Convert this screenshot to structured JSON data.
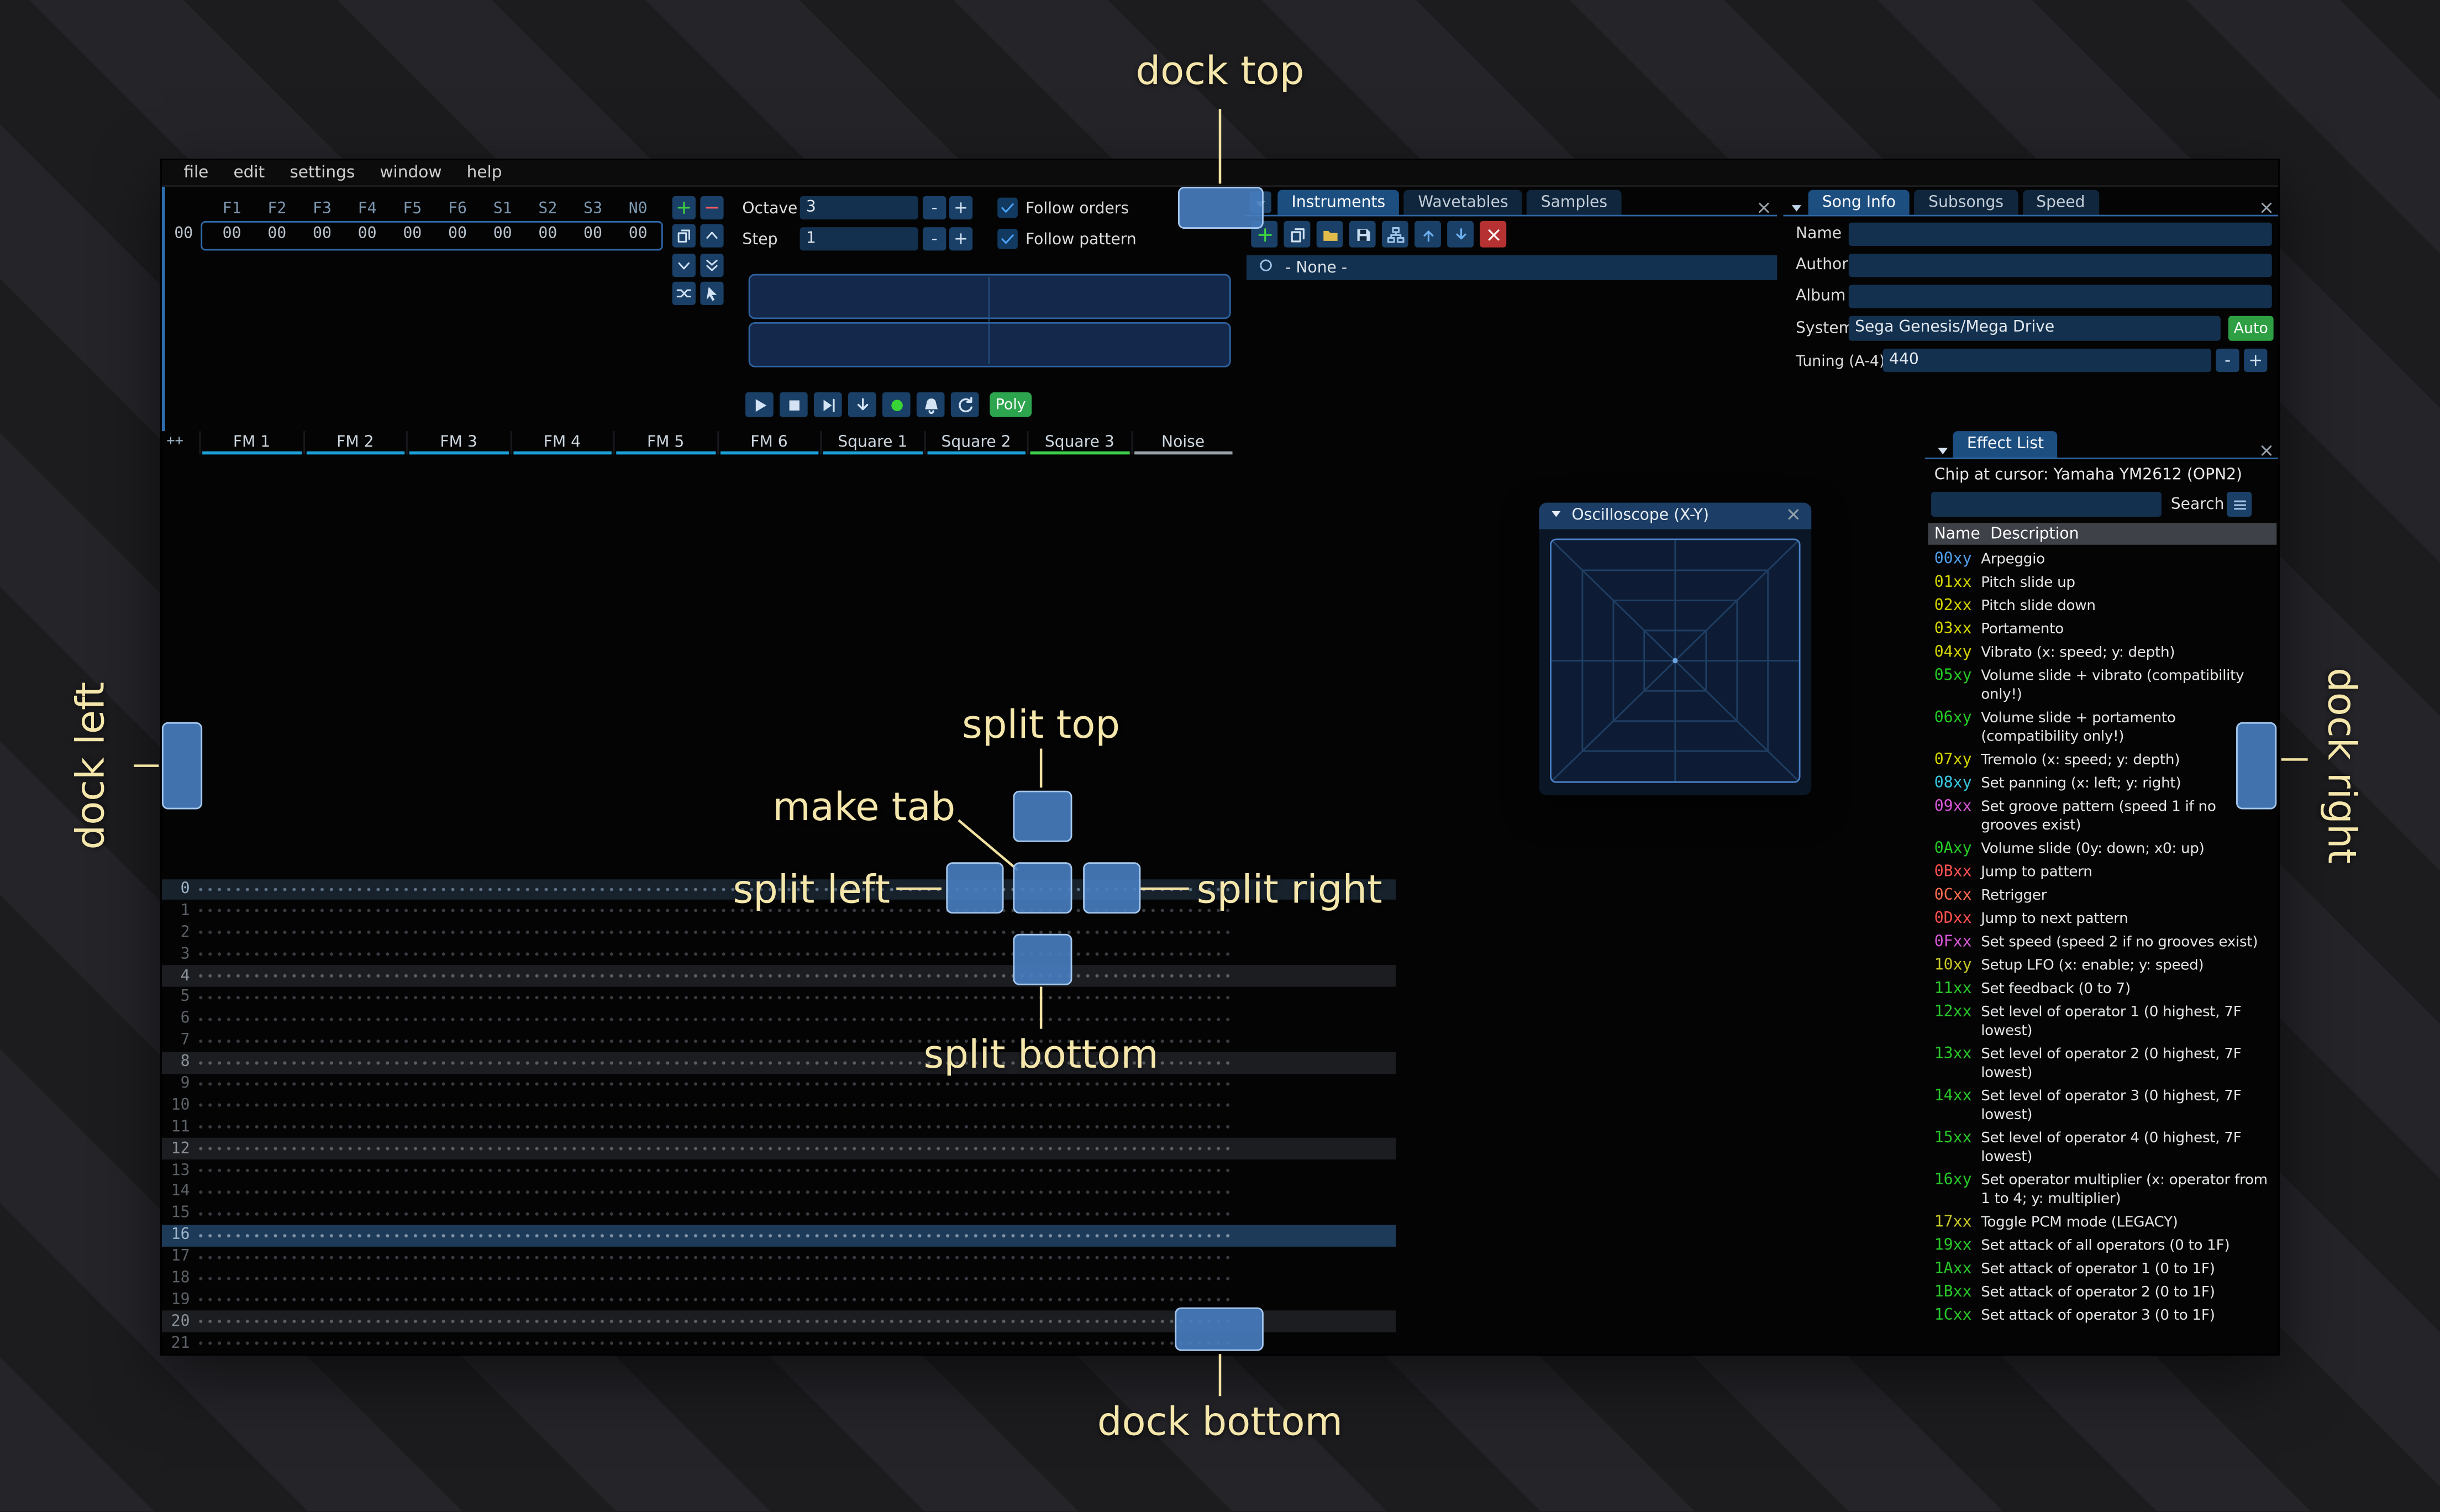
{
  "ui": {
    "minus": "-",
    "plus": "+"
  },
  "menu": {
    "items": [
      "file",
      "edit",
      "settings",
      "window",
      "help"
    ]
  },
  "orders": {
    "row_index": "00",
    "channel_headers": [
      "F1",
      "F2",
      "F3",
      "F4",
      "F5",
      "F6",
      "S1",
      "S2",
      "S3",
      "N0"
    ],
    "row_values": [
      "00",
      "00",
      "00",
      "00",
      "00",
      "00",
      "00",
      "00",
      "00",
      "00"
    ],
    "buttons": [
      {
        "icon": "plus",
        "name": "add-order-button",
        "color": "#3fd23f"
      },
      {
        "icon": "minus",
        "name": "remove-order-button",
        "color": "#ff5c5c"
      },
      {
        "icon": "copy",
        "name": "duplicate-order-button"
      },
      {
        "icon": "chevron-up",
        "name": "move-order-up-button"
      },
      {
        "icon": "chevron-down",
        "name": "move-order-down-button"
      },
      {
        "icon": "double-down",
        "name": "deep-clone-order-button"
      },
      {
        "icon": "shuffle",
        "name": "order-change-all-button"
      },
      {
        "icon": "cursor",
        "name": "order-edit-mode-button"
      }
    ]
  },
  "transport": {
    "octave_label": "Octave",
    "octave": "3",
    "step_label": "Step",
    "step": "1",
    "follow_orders": "Follow orders",
    "follow_pattern": "Follow pattern",
    "poly": "Poly",
    "buttons": [
      {
        "icon": "play",
        "name": "play-button"
      },
      {
        "icon": "stop",
        "name": "stop-button"
      },
      {
        "icon": "step",
        "name": "play-from-cursor-button"
      },
      {
        "icon": "arrow-down",
        "name": "step-row-button"
      },
      {
        "icon": "record",
        "name": "record-button",
        "color": "#37d337"
      },
      {
        "icon": "bell",
        "name": "metronome-button"
      },
      {
        "icon": "repeat",
        "name": "repeat-pattern-button"
      }
    ]
  },
  "instruments": {
    "tabs": [
      "Instruments",
      "Wavetables",
      "Samples"
    ],
    "active_tab": 0,
    "list": [
      "- None -"
    ],
    "toolbar": [
      {
        "icon": "plus",
        "name": "add-instrument-button",
        "color": "#3fd23f"
      },
      {
        "icon": "copy",
        "name": "duplicate-instrument-button"
      },
      {
        "icon": "folder",
        "name": "open-instrument-button",
        "color": "#e2bb4a"
      },
      {
        "icon": "floppy",
        "name": "save-instrument-button",
        "color": "#c9ddf2"
      },
      {
        "icon": "tree",
        "name": "instrument-folders-button",
        "color": "#9fc3e8"
      },
      {
        "icon": "arrow-up",
        "name": "move-instrument-up-button",
        "color": "#6fb1f0"
      },
      {
        "icon": "arrow-down",
        "name": "move-instrument-down-button",
        "color": "#6fb1f0"
      },
      {
        "icon": "close",
        "name": "delete-instrument-button",
        "color": "#ffffff",
        "danger": true
      }
    ]
  },
  "song_info": {
    "tabs": [
      "Song Info",
      "Subsongs",
      "Speed"
    ],
    "active_tab": 0,
    "labels": {
      "name": "Name",
      "author": "Author",
      "album": "Album",
      "system": "System",
      "tuning": "Tuning (A-4)"
    },
    "values": {
      "name": "",
      "author": "",
      "album": "",
      "system": "Sega Genesis/Mega Drive",
      "tuning": "440"
    },
    "auto_label": "Auto"
  },
  "pattern": {
    "corner": "++",
    "channels": [
      {
        "name": "FM 1",
        "color": "#1ba2da"
      },
      {
        "name": "FM 2",
        "color": "#1ba2da"
      },
      {
        "name": "FM 3",
        "color": "#1ba2da"
      },
      {
        "name": "FM 4",
        "color": "#1ba2da"
      },
      {
        "name": "FM 5",
        "color": "#1ba2da"
      },
      {
        "name": "FM 6",
        "color": "#1ba2da"
      },
      {
        "name": "Square 1",
        "color": "#1ba2da"
      },
      {
        "name": "Square 2",
        "color": "#1ba2da"
      },
      {
        "name": "Square 3",
        "color": "#3ecf4a"
      },
      {
        "name": "Noise",
        "color": "#9aa2aa"
      }
    ],
    "rows": [
      0,
      1,
      2,
      3,
      4,
      5,
      6,
      7,
      8,
      9,
      10,
      11,
      12,
      13,
      14,
      15,
      16,
      17,
      18,
      19,
      20,
      21
    ],
    "row_count": 22,
    "cursor_row": 16,
    "highlight1": [
      4,
      8,
      12,
      20
    ],
    "highlight2": [
      0
    ]
  },
  "oscilloscope": {
    "title": "Oscilloscope (X-Y)"
  },
  "effect_list": {
    "title": "Effect List",
    "chip_line": "Chip at cursor: Yamaha YM2612 (OPN2)",
    "search_label": "Search",
    "columns": [
      "Name",
      "Description"
    ],
    "effects": [
      {
        "code": "00xy",
        "type": "misc",
        "desc": "Arpeggio"
      },
      {
        "code": "01xx",
        "type": "pitch",
        "desc": "Pitch slide up"
      },
      {
        "code": "02xx",
        "type": "pitch",
        "desc": "Pitch slide down"
      },
      {
        "code": "03xx",
        "type": "pitch",
        "desc": "Portamento"
      },
      {
        "code": "04xy",
        "type": "pitch",
        "desc": "Vibrato (x: speed; y: depth)"
      },
      {
        "code": "05xy",
        "type": "volume",
        "desc": "Volume slide + vibrato (compatibility only!)"
      },
      {
        "code": "06xy",
        "type": "volume",
        "desc": "Volume slide + portamento (compatibility only!)"
      },
      {
        "code": "07xy",
        "type": "pitch",
        "desc": "Tremolo (x: speed; y: depth)"
      },
      {
        "code": "08xy",
        "type": "panning",
        "desc": "Set panning (x: left; y: right)"
      },
      {
        "code": "09xx",
        "type": "speed",
        "desc": "Set groove pattern (speed 1 if no grooves exist)"
      },
      {
        "code": "0Axy",
        "type": "volume",
        "desc": "Volume slide (0y: down; x0: up)"
      },
      {
        "code": "0Bxx",
        "type": "song",
        "desc": "Jump to pattern"
      },
      {
        "code": "0Cxx",
        "type": "time",
        "desc": "Retrigger"
      },
      {
        "code": "0Dxx",
        "type": "song",
        "desc": "Jump to next pattern"
      },
      {
        "code": "0Fxx",
        "type": "speed",
        "desc": "Set speed (speed 2 if no grooves exist)"
      },
      {
        "code": "10xy",
        "type": "sys2",
        "desc": "Setup LFO (x: enable; y: speed)"
      },
      {
        "code": "11xx",
        "type": "sys1",
        "desc": "Set feedback (0 to 7)"
      },
      {
        "code": "12xx",
        "type": "sys1",
        "desc": "Set level of operator 1 (0 highest, 7F lowest)"
      },
      {
        "code": "13xx",
        "type": "sys1",
        "desc": "Set level of operator 2 (0 highest, 7F lowest)"
      },
      {
        "code": "14xx",
        "type": "sys1",
        "desc": "Set level of operator 3 (0 highest, 7F lowest)"
      },
      {
        "code": "15xx",
        "type": "sys1",
        "desc": "Set level of operator 4 (0 highest, 7F lowest)"
      },
      {
        "code": "16xy",
        "type": "sys1",
        "desc": "Set operator multiplier (x: operator from 1 to 4; y: multiplier)"
      },
      {
        "code": "17xx",
        "type": "sys2",
        "desc": "Toggle PCM mode (LEGACY)"
      },
      {
        "code": "19xx",
        "type": "sys1",
        "desc": "Set attack of all operators (0 to 1F)"
      },
      {
        "code": "1Axx",
        "type": "sys1",
        "desc": "Set attack of operator 1 (0 to 1F)"
      },
      {
        "code": "1Bxx",
        "type": "sys1",
        "desc": "Set attack of operator 2 (0 to 1F)"
      },
      {
        "code": "1Cxx",
        "type": "sys1",
        "desc": "Set attack of operator 3 (0 to 1F)"
      }
    ]
  },
  "overlay": {
    "dock_top": "dock top",
    "dock_bottom": "dock bottom",
    "dock_left": "dock left",
    "dock_right": "dock right",
    "split_top": "split top",
    "split_bottom": "split bottom",
    "split_left": "split left",
    "split_right": "split right",
    "make_tab": "make tab"
  },
  "colors": {
    "accent": "#2d5e9e",
    "icon": "#d3e3f3",
    "record": "#37d337",
    "green_button": "#2da44e",
    "danger": "#b63232",
    "overlay_box": "#4a7ec1",
    "overlay_label": "#f5e7ab",
    "effect_types": {
      "misc": "#4f9fee",
      "pitch": "#d5d500",
      "volume": "#25cc25",
      "panning": "#39c7e0",
      "speed": "#d957d9",
      "song": "#ff5050",
      "time": "#ff6e4f",
      "sys1": "#28c828",
      "sys2": "#c8c828"
    }
  }
}
